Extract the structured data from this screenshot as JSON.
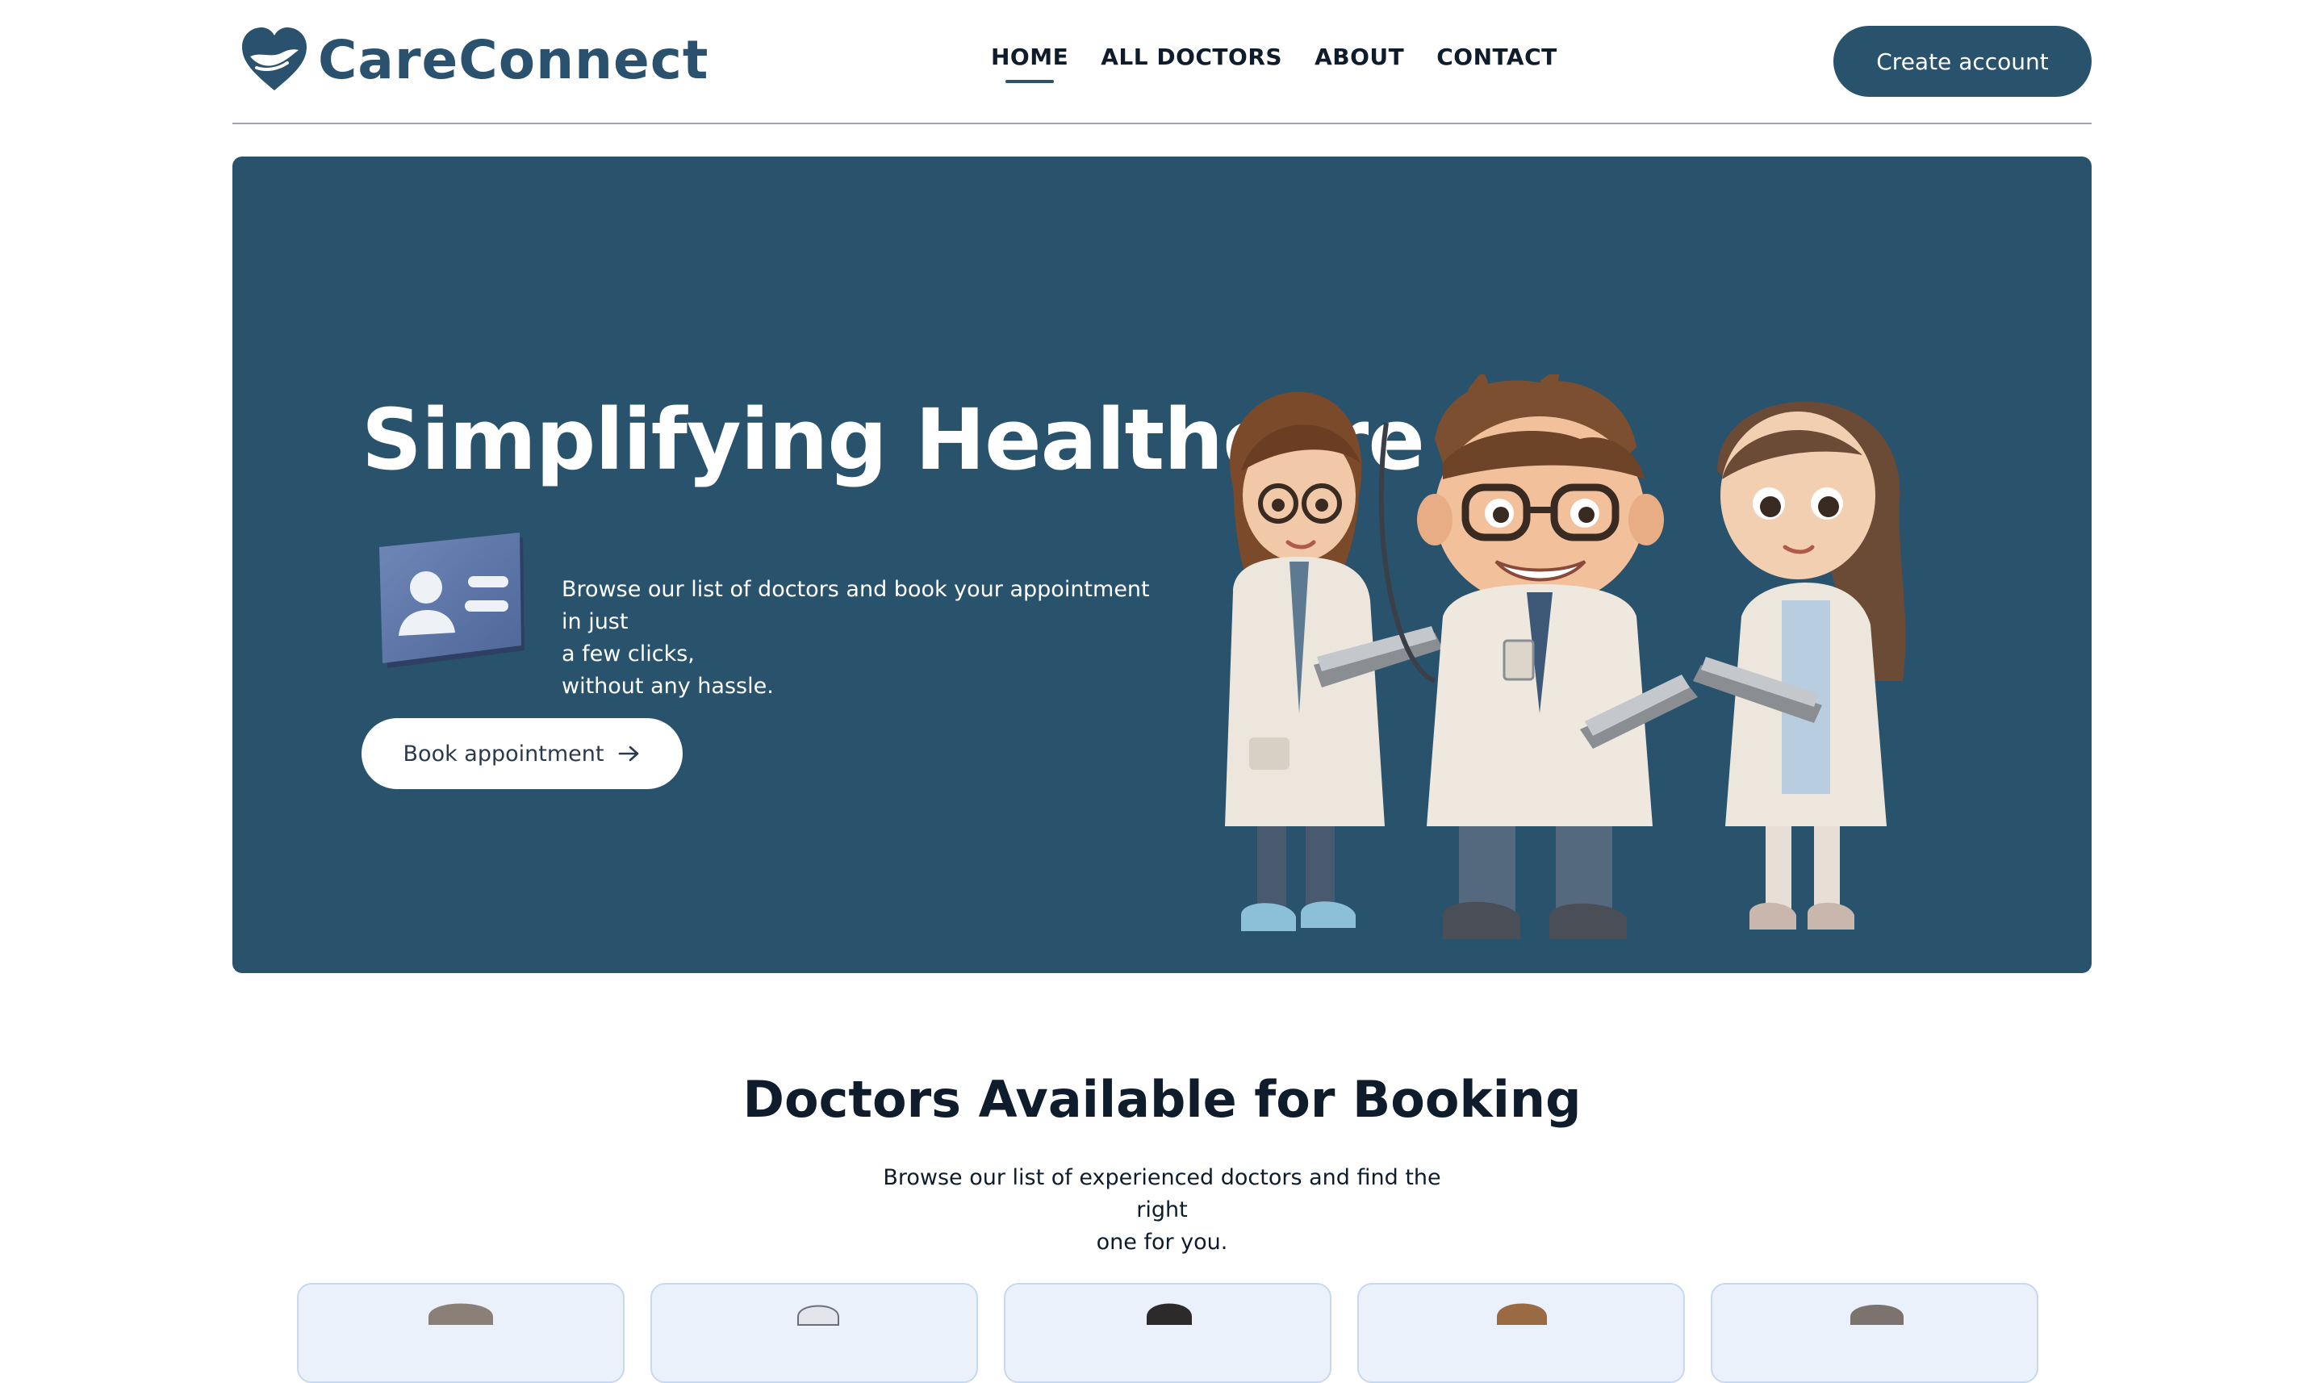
{
  "nav": {
    "brand": "CareConnect",
    "links": [
      {
        "label": "HOME",
        "active": true
      },
      {
        "label": "ALL DOCTORS",
        "active": false
      },
      {
        "label": "ABOUT",
        "active": false
      },
      {
        "label": "CONTACT",
        "active": false
      }
    ],
    "create_account_label": "Create account"
  },
  "hero": {
    "title": "Simplifying Healthcare",
    "description_lines": [
      "Browse our list of doctors and book your appointment in just",
      "a few clicks,",
      "without any hassle."
    ],
    "book_label": "Book appointment",
    "book_icon": "arrow-right-icon",
    "card_icon": "id-card-icon",
    "illustration": "three-cartoon-doctors-illustration"
  },
  "section": {
    "title": "Doctors Available for Booking",
    "subtitle_lines": [
      "Browse our list of experienced doctors and find the right",
      "one for you."
    ]
  },
  "doctor_cards_count": 5,
  "colors": {
    "brand": "#29526d",
    "card_bg": "#eaf1fb",
    "card_border": "#c8d9ef",
    "text": "#0f1c2b"
  }
}
